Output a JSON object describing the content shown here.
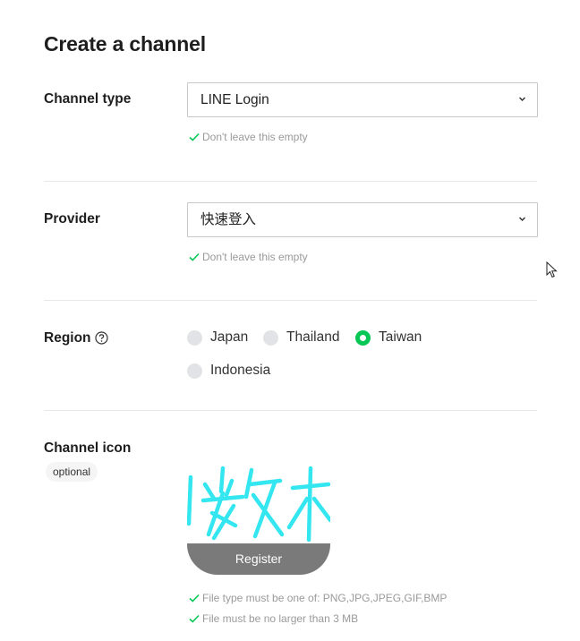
{
  "page_title": "Create a channel",
  "channel_type": {
    "label": "Channel type",
    "value": "LINE Login",
    "hint": "Don't leave this empty"
  },
  "provider": {
    "label": "Provider",
    "value": "快速登入",
    "hint": "Don't leave this empty"
  },
  "region": {
    "label": "Region",
    "options": [
      "Japan",
      "Thailand",
      "Taiwan",
      "Indonesia"
    ],
    "selected": "Taiwan"
  },
  "channel_icon": {
    "label": "Channel icon",
    "badge": "optional",
    "register_label": "Register",
    "hints": [
      "File type must be one of: PNG,JPG,JPEG,GIF,BMP",
      "File must be no larger than 3 MB"
    ]
  },
  "colors": {
    "accent_green": "#06c755",
    "hint_gray": "#9a9a9a",
    "icon_art_cyan": "#33e6f0"
  }
}
